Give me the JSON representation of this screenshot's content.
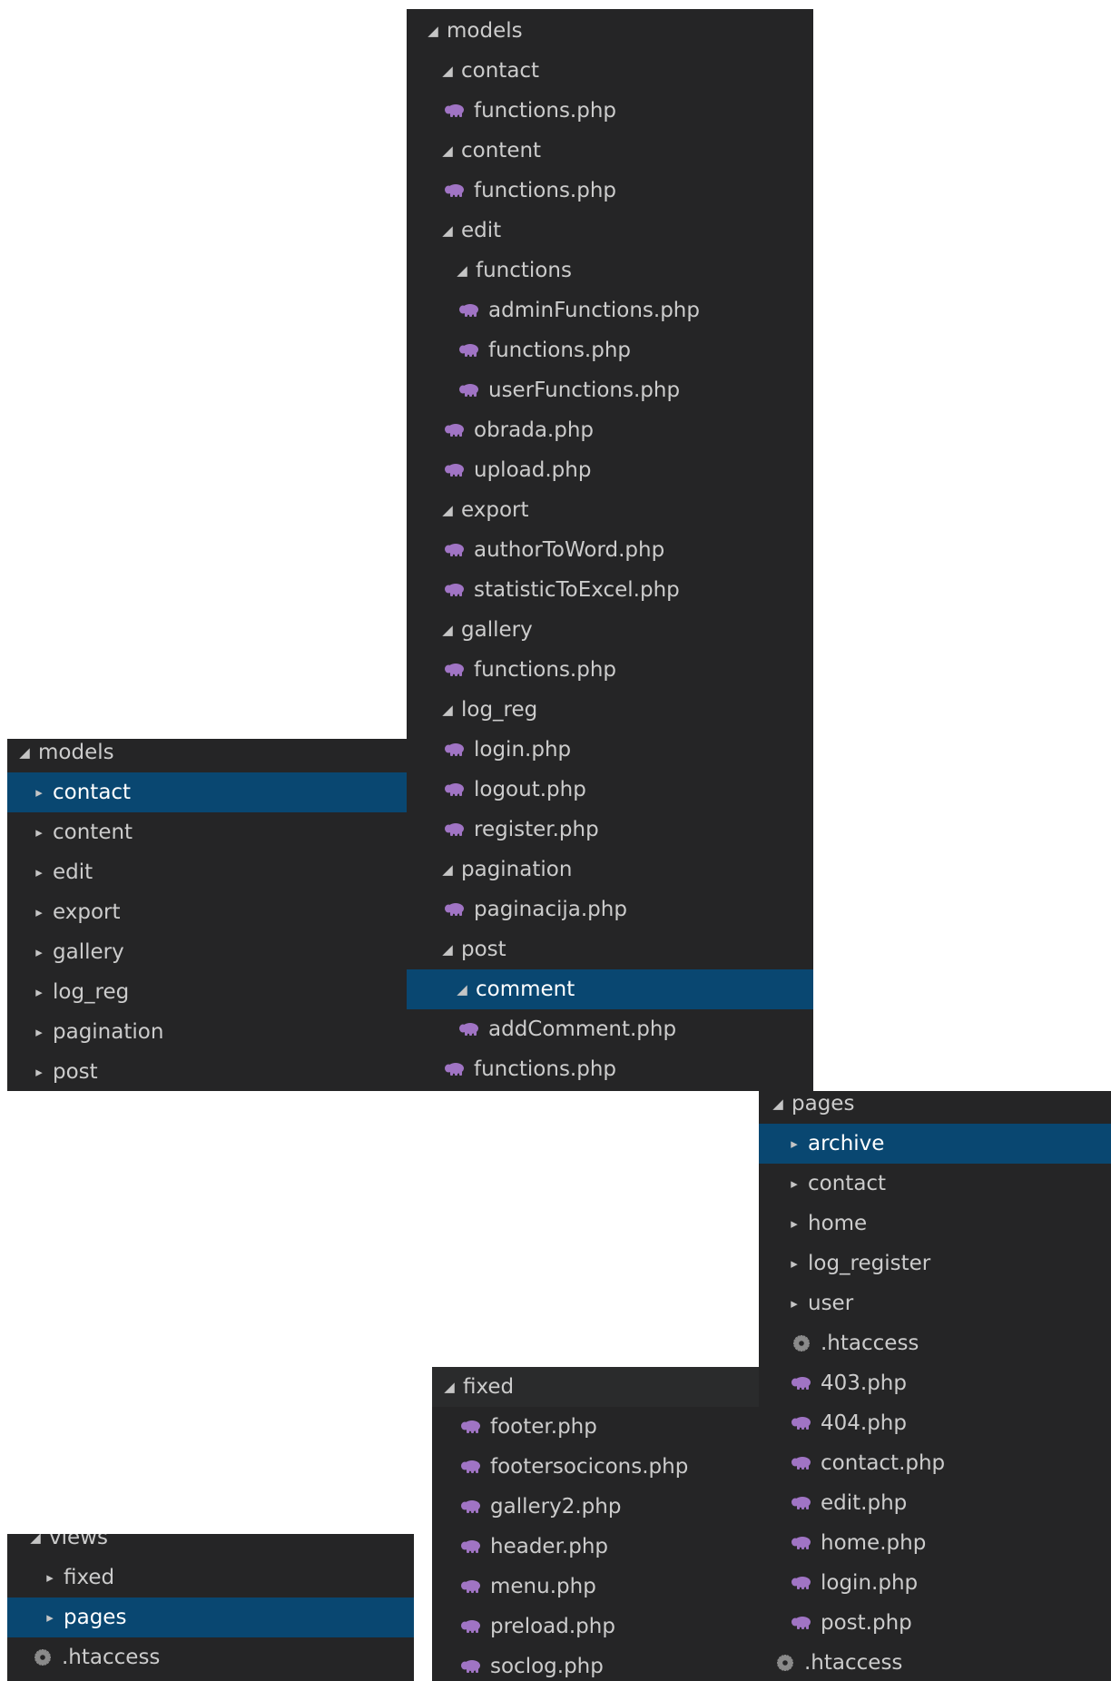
{
  "colors": {
    "panel_bg": "#252526",
    "selected_bg": "#094771",
    "php_icon": "#a074c4",
    "gear_icon": "#8a8a8a"
  },
  "panel_models_collapsed": {
    "items": [
      {
        "label": "models",
        "type": "folder",
        "state": "expanded",
        "depth": 0
      },
      {
        "label": "contact",
        "type": "folder",
        "state": "collapsed",
        "depth": 1,
        "selected": true
      },
      {
        "label": "content",
        "type": "folder",
        "state": "collapsed",
        "depth": 1
      },
      {
        "label": "edit",
        "type": "folder",
        "state": "collapsed",
        "depth": 1
      },
      {
        "label": "export",
        "type": "folder",
        "state": "collapsed",
        "depth": 1
      },
      {
        "label": "gallery",
        "type": "folder",
        "state": "collapsed",
        "depth": 1
      },
      {
        "label": "log_reg",
        "type": "folder",
        "state": "collapsed",
        "depth": 1
      },
      {
        "label": "pagination",
        "type": "folder",
        "state": "collapsed",
        "depth": 1
      },
      {
        "label": "post",
        "type": "folder",
        "state": "collapsed",
        "depth": 1
      }
    ]
  },
  "panel_models_expanded": {
    "items": [
      {
        "label": "models",
        "type": "folder",
        "state": "expanded",
        "depth": 0
      },
      {
        "label": "contact",
        "type": "folder",
        "state": "expanded",
        "depth": 1
      },
      {
        "label": "functions.php",
        "type": "php",
        "depth": 1
      },
      {
        "label": "content",
        "type": "folder",
        "state": "expanded",
        "depth": 1
      },
      {
        "label": "functions.php",
        "type": "php",
        "depth": 1
      },
      {
        "label": "edit",
        "type": "folder",
        "state": "expanded",
        "depth": 1
      },
      {
        "label": "functions",
        "type": "folder",
        "state": "expanded",
        "depth": 2
      },
      {
        "label": "adminFunctions.php",
        "type": "php",
        "depth": 2
      },
      {
        "label": "functions.php",
        "type": "php",
        "depth": 2
      },
      {
        "label": "userFunctions.php",
        "type": "php",
        "depth": 2
      },
      {
        "label": "obrada.php",
        "type": "php",
        "depth": 1
      },
      {
        "label": "upload.php",
        "type": "php",
        "depth": 1
      },
      {
        "label": "export",
        "type": "folder",
        "state": "expanded",
        "depth": 1
      },
      {
        "label": "authorToWord.php",
        "type": "php",
        "depth": 1
      },
      {
        "label": "statisticToExcel.php",
        "type": "php",
        "depth": 1
      },
      {
        "label": "gallery",
        "type": "folder",
        "state": "expanded",
        "depth": 1
      },
      {
        "label": "functions.php",
        "type": "php",
        "depth": 1
      },
      {
        "label": "log_reg",
        "type": "folder",
        "state": "expanded",
        "depth": 1
      },
      {
        "label": "login.php",
        "type": "php",
        "depth": 1
      },
      {
        "label": "logout.php",
        "type": "php",
        "depth": 1
      },
      {
        "label": "register.php",
        "type": "php",
        "depth": 1
      },
      {
        "label": "pagination",
        "type": "folder",
        "state": "expanded",
        "depth": 1
      },
      {
        "label": "paginacija.php",
        "type": "php",
        "depth": 1
      },
      {
        "label": "post",
        "type": "folder",
        "state": "expanded",
        "depth": 1
      },
      {
        "label": "comment",
        "type": "folder",
        "state": "expanded",
        "depth": 2,
        "selected": true
      },
      {
        "label": "addComment.php",
        "type": "php",
        "depth": 2
      },
      {
        "label": "functions.php",
        "type": "php",
        "depth": 1
      }
    ]
  },
  "panel_pages": {
    "items": [
      {
        "label": "pages",
        "type": "folder",
        "state": "expanded",
        "depth": 0
      },
      {
        "label": "archive",
        "type": "folder",
        "state": "collapsed",
        "depth": 1,
        "selected": true
      },
      {
        "label": "contact",
        "type": "folder",
        "state": "collapsed",
        "depth": 1
      },
      {
        "label": "home",
        "type": "folder",
        "state": "collapsed",
        "depth": 1
      },
      {
        "label": "log_register",
        "type": "folder",
        "state": "collapsed",
        "depth": 1
      },
      {
        "label": "user",
        "type": "folder",
        "state": "collapsed",
        "depth": 1
      },
      {
        "label": ".htaccess",
        "type": "config",
        "depth": 1
      },
      {
        "label": "403.php",
        "type": "php",
        "depth": 1
      },
      {
        "label": "404.php",
        "type": "php",
        "depth": 1
      },
      {
        "label": "contact.php",
        "type": "php",
        "depth": 1
      },
      {
        "label": "edit.php",
        "type": "php",
        "depth": 1
      },
      {
        "label": "home.php",
        "type": "php",
        "depth": 1
      },
      {
        "label": "login.php",
        "type": "php",
        "depth": 1
      },
      {
        "label": "post.php",
        "type": "php",
        "depth": 1
      },
      {
        "label": ".htaccess",
        "type": "config",
        "depth": 0
      }
    ]
  },
  "panel_fixed": {
    "items": [
      {
        "label": "fixed",
        "type": "folder",
        "state": "expanded",
        "depth": 0,
        "header": true
      },
      {
        "label": "footer.php",
        "type": "php",
        "depth": 1
      },
      {
        "label": "footersocicons.php",
        "type": "php",
        "depth": 1
      },
      {
        "label": "gallery2.php",
        "type": "php",
        "depth": 1
      },
      {
        "label": "header.php",
        "type": "php",
        "depth": 1
      },
      {
        "label": "menu.php",
        "type": "php",
        "depth": 1
      },
      {
        "label": "preload.php",
        "type": "php",
        "depth": 1
      },
      {
        "label": "soclog.php",
        "type": "php",
        "depth": 1
      }
    ]
  },
  "panel_views": {
    "items": [
      {
        "label": "views",
        "type": "folder",
        "state": "expanded",
        "depth": 0
      },
      {
        "label": "fixed",
        "type": "folder",
        "state": "collapsed",
        "depth": 1
      },
      {
        "label": "pages",
        "type": "folder",
        "state": "collapsed",
        "depth": 1,
        "selected": true
      },
      {
        "label": ".htaccess",
        "type": "config",
        "depth": 0
      }
    ]
  }
}
